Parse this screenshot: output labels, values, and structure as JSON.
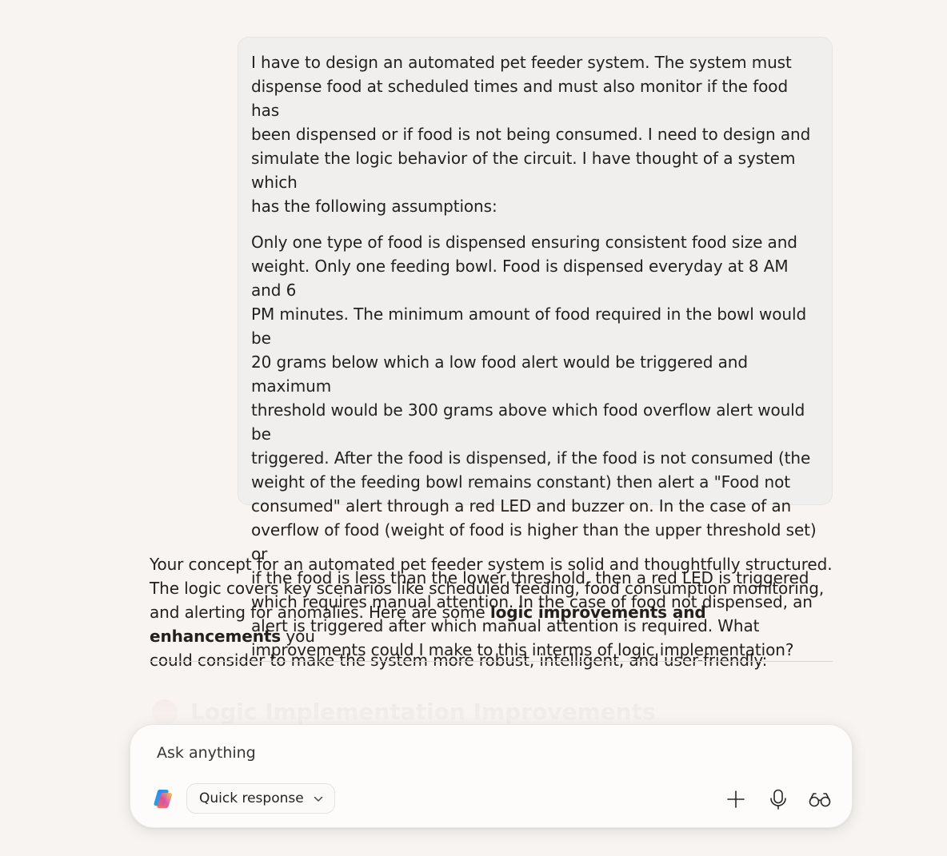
{
  "conversation": {
    "user_message": {
      "paragraphs": [
        "I have to design an automated pet feeder system. The system must\ndispense food at scheduled times and must also monitor if the food has\nbeen dispensed or if food is not being consumed. I need to design and\nsimulate the logic behavior of the circuit. I have thought of a system which\nhas the following assumptions:",
        "Only one type of food is dispensed ensuring consistent food size and\nweight. Only one feeding bowl. Food is dispensed everyday at 8 AM and 6\nPM minutes. The minimum amount of food required in the bowl would be\n20 grams below which a low food alert would be triggered and maximum\nthreshold would be 300 grams above which food overflow alert would be\ntriggered. After the food is dispensed, if the food is not consumed (the\nweight of the feeding bowl remains constant) then alert a \"Food not\nconsumed\" alert through a red LED and buzzer on. In the case of an\noverflow of food (weight of food is higher than the upper threshold set) or\nif the food is less than the lower threshold, then a red LED is triggered\nwhich requires manual attention. In the case of food not dispensed, an\nalert is triggered after which manual attention is required. What\nimprovements could I make to this interms of logic implementation?"
      ]
    },
    "assistant_message": {
      "text_before_bold": "Your concept for an automated pet feeder system is solid and thoughtfully structured.\nThe logic covers key scenarios like scheduled feeding, food consumption monitoring,\nand alerting for anomalies. Here are some ",
      "bold_text": "logic improvements and enhancements",
      "text_after_bold": " you\ncould consider to make the system more robust, intelligent, and user-friendly:",
      "faded_heading": "Logic Implementation Improvements"
    }
  },
  "composer": {
    "placeholder": "Ask anything",
    "mode_label": "Quick response",
    "icons": {
      "logo": "copilot-logo-icon",
      "mode_dropdown": "chevron-down-icon",
      "add": "plus-icon",
      "voice": "microphone-icon",
      "vision": "glasses-icon"
    }
  },
  "colors": {
    "background": "#f7f4f1",
    "user_bubble": "#f0efed",
    "text": "#231f1c",
    "divider": "#e3d3cb",
    "composer": "#fdfcfb"
  }
}
